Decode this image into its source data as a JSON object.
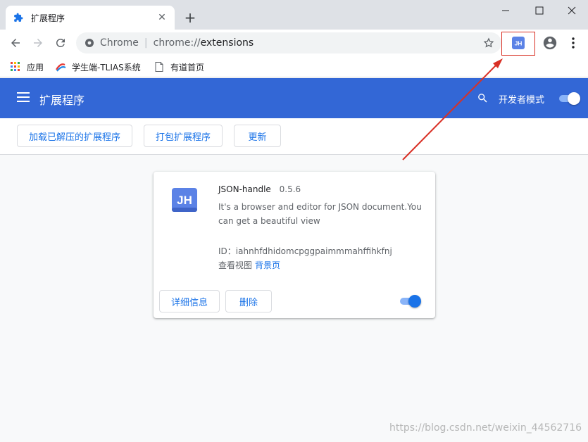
{
  "tab": {
    "title": "扩展程序",
    "close_glyph": "✕",
    "new_tab_glyph": "+"
  },
  "window": {
    "minimize": "—",
    "maximize": "☐",
    "close": "✕"
  },
  "omnibox": {
    "scheme": "Chrome",
    "separator": "|",
    "url_prefix": "chrome://",
    "url_path": "extensions"
  },
  "extension_button": {
    "initials": "JH"
  },
  "bookmarks": [
    {
      "label": "应用",
      "icon": "apps-grid-icon"
    },
    {
      "label": "学生端-TLIAS系统",
      "icon": "site-logo-icon"
    },
    {
      "label": "有道首页",
      "icon": "page-icon"
    }
  ],
  "header": {
    "title": "扩展程序",
    "dev_mode_label": "开发者模式",
    "dev_mode_on": true
  },
  "actions": {
    "load_unpacked": "加载已解压的扩展程序",
    "pack": "打包扩展程序",
    "update": "更新"
  },
  "extension": {
    "logo_text": "JH",
    "name": "JSON-handle",
    "version": "0.5.6",
    "description": "It's a browser and editor for JSON document.You can get a beautiful view",
    "id_label": "ID：iahnhfdhidomcpggpaimmmahffihkfnj",
    "views_label": "查看视图",
    "views_link": "背景页",
    "details_button": "详细信息",
    "remove_button": "删除",
    "enabled": true
  },
  "watermark": "https://blog.csdn.net/weixin_44562716",
  "colors": {
    "header_blue": "#3367d6",
    "accent": "#1a73e8",
    "annotation_red": "#d93025",
    "logo_blue": "#5b82e6"
  }
}
